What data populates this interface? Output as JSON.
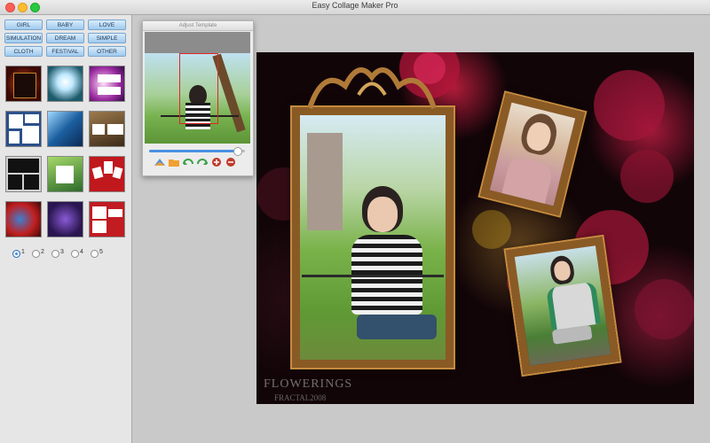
{
  "window": {
    "title": "Easy Collage Maker Pro"
  },
  "categories": [
    "GIRL",
    "BABY",
    "LOVE",
    "SIMULATION",
    "DREAM",
    "SIMPLE",
    "CLOTH",
    "FESTIVAL",
    "OTHER"
  ],
  "templates": [
    {
      "name": "template-dark-flame"
    },
    {
      "name": "template-teal-glow"
    },
    {
      "name": "template-purple-three"
    },
    {
      "name": "template-blue-grid"
    },
    {
      "name": "template-blue-sparkle"
    },
    {
      "name": "template-brown-two"
    },
    {
      "name": "template-black-grid"
    },
    {
      "name": "template-green-center"
    },
    {
      "name": "template-red-three"
    },
    {
      "name": "template-red-swirl"
    },
    {
      "name": "template-purple-orbs"
    },
    {
      "name": "template-red-blocks"
    }
  ],
  "pages": [
    "1",
    "2",
    "3",
    "4",
    "5"
  ],
  "selected_page": "1",
  "adjust_window": {
    "title": "Adjust Template",
    "zoom_level": 0.92
  },
  "canvas": {
    "watermark": "FLOWERINGS",
    "watermark_sub": "FRACTAL2008"
  },
  "colors": {
    "frame": "#8a5a25",
    "accent": "#3a8ee6",
    "button": "#9fcaee"
  }
}
